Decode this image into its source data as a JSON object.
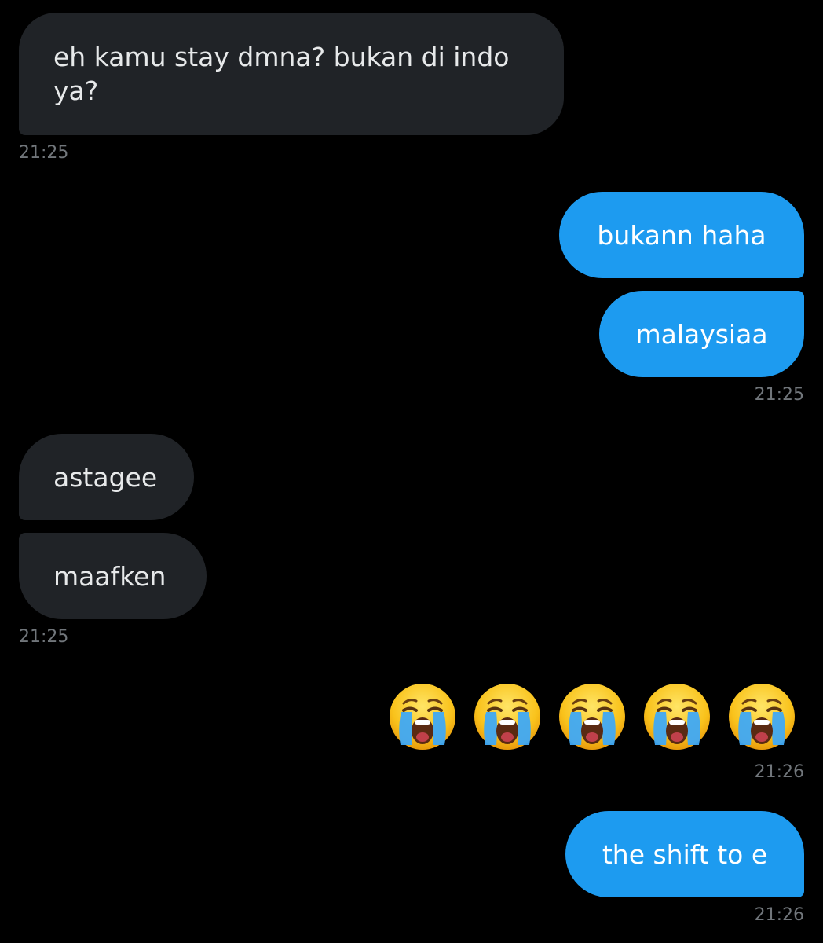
{
  "messages": {
    "in1": {
      "text": "eh kamu stay dmna? bukan di indo ya?",
      "time": "21:25"
    },
    "out1a": {
      "text": "bukann haha"
    },
    "out1b": {
      "text": "malaysiaa",
      "time": "21:25"
    },
    "in2a": {
      "text": "astagee"
    },
    "in2b": {
      "text": "maafken",
      "time": "21:25"
    },
    "emoji": {
      "icon": "loudly-crying-face-emoji",
      "count": 5,
      "time": "21:26"
    },
    "out3": {
      "text": "the shift to e",
      "time": "21:26"
    }
  },
  "colors": {
    "background": "#000000",
    "incoming_bubble": "#202327",
    "outgoing_bubble": "#1d9bf0",
    "incoming_text": "#e7e9ea",
    "timestamp": "#71767b"
  }
}
